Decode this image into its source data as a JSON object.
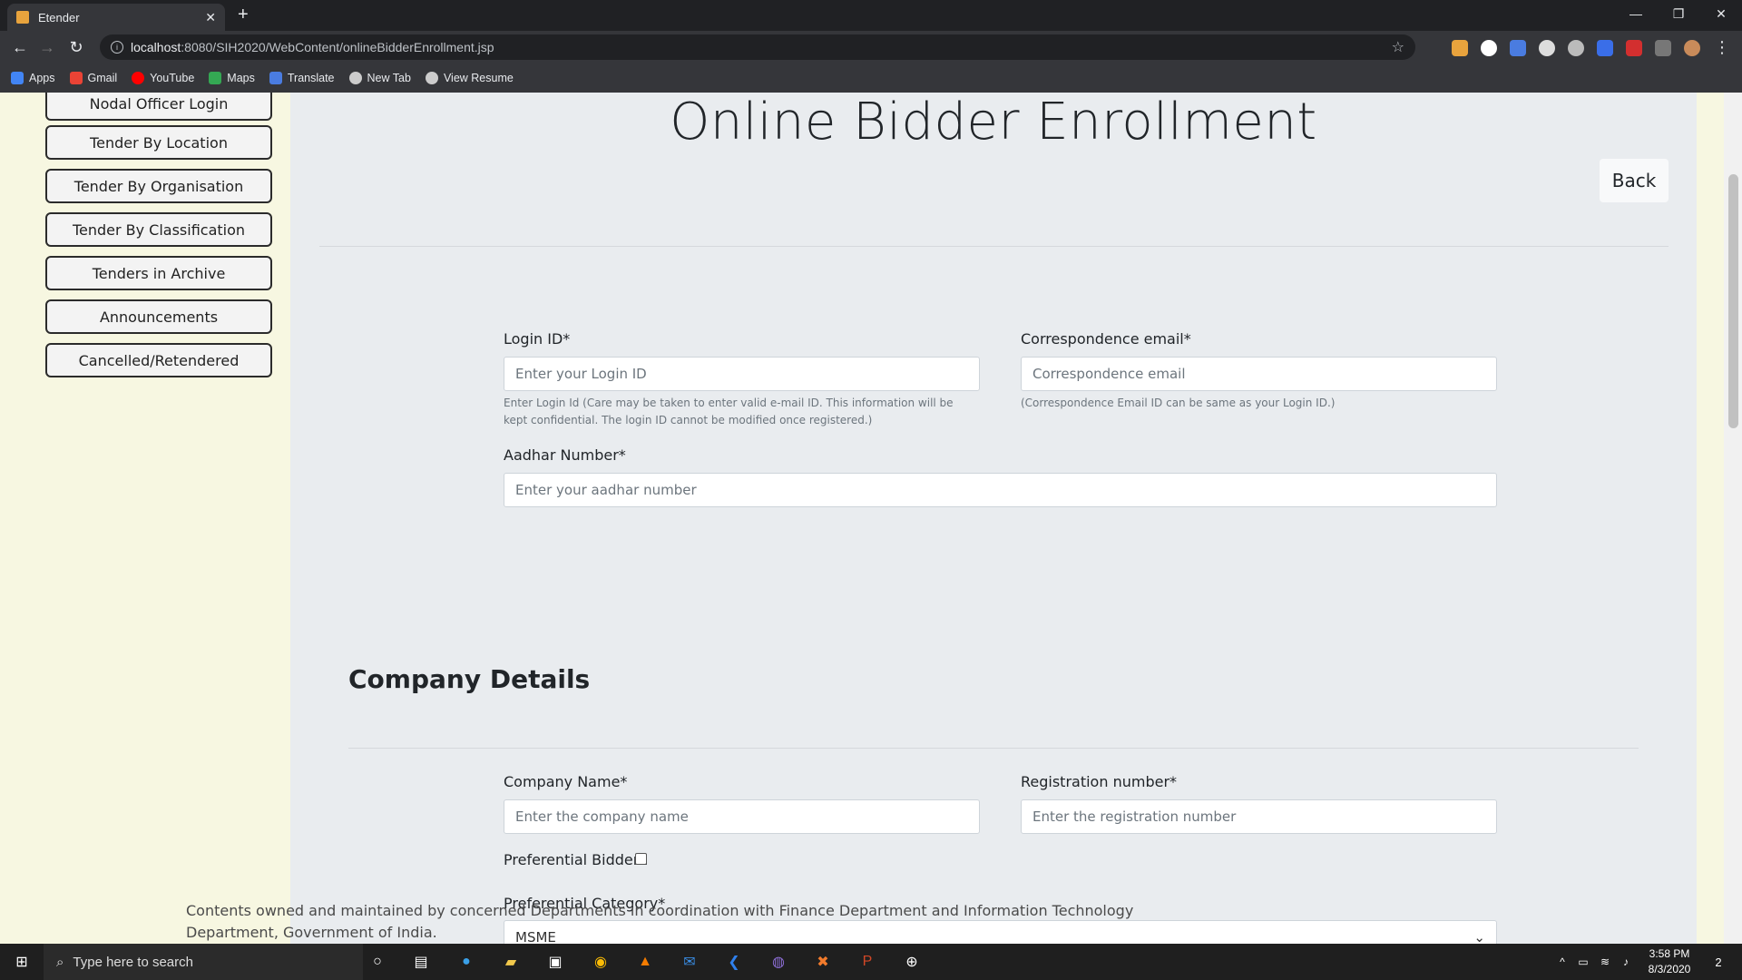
{
  "browser": {
    "tab_title": "Etender",
    "tab_close": "✕",
    "new_tab": "+",
    "url_host": "localhost",
    "url_path": ":8080/SIH2020/WebContent/onlineBidderEnrollment.jsp",
    "bookmarks": [
      "Apps",
      "Gmail",
      "YouTube",
      "Maps",
      "Translate",
      "New Tab",
      "View Resume"
    ]
  },
  "sidebar": {
    "items": [
      "Nodal Officer Login",
      "Tender By Location",
      "Tender By Organisation",
      "Tender By Classification",
      "Tenders in Archive",
      "Announcements",
      "Cancelled/Retendered"
    ]
  },
  "page": {
    "title": "Online Bidder Enrollment",
    "back_label": "Back"
  },
  "form": {
    "login_id_label": "Login ID*",
    "login_id_placeholder": "Enter your Login ID",
    "login_id_help": "Enter Login Id (Care may be taken to enter valid e-mail ID. This information will be kept confidential. The login ID cannot be modified once registered.)",
    "email_label": "Correspondence email*",
    "email_placeholder": "Correspondence email",
    "email_help": "(Correspondence Email ID can be same as your Login ID.)",
    "aadhar_label": "Aadhar Number*",
    "aadhar_placeholder": "Enter your aadhar number"
  },
  "company": {
    "section_title": "Company Details",
    "name_label": "Company Name*",
    "name_placeholder": "Enter the company name",
    "reg_label": "Registration number*",
    "reg_placeholder": "Enter the registration number",
    "preferential_label": "Preferential Bidder :",
    "category_label": "Preferential Category*",
    "category_value": "MSME"
  },
  "footer": {
    "text": "Contents owned and maintained by concerned Departments in coordination with Finance Department and Information Technology Department, Government of India."
  },
  "taskbar": {
    "search_placeholder": "Type here to search",
    "time": "3:58 PM",
    "date": "8/3/2020",
    "notification_count": "2"
  }
}
